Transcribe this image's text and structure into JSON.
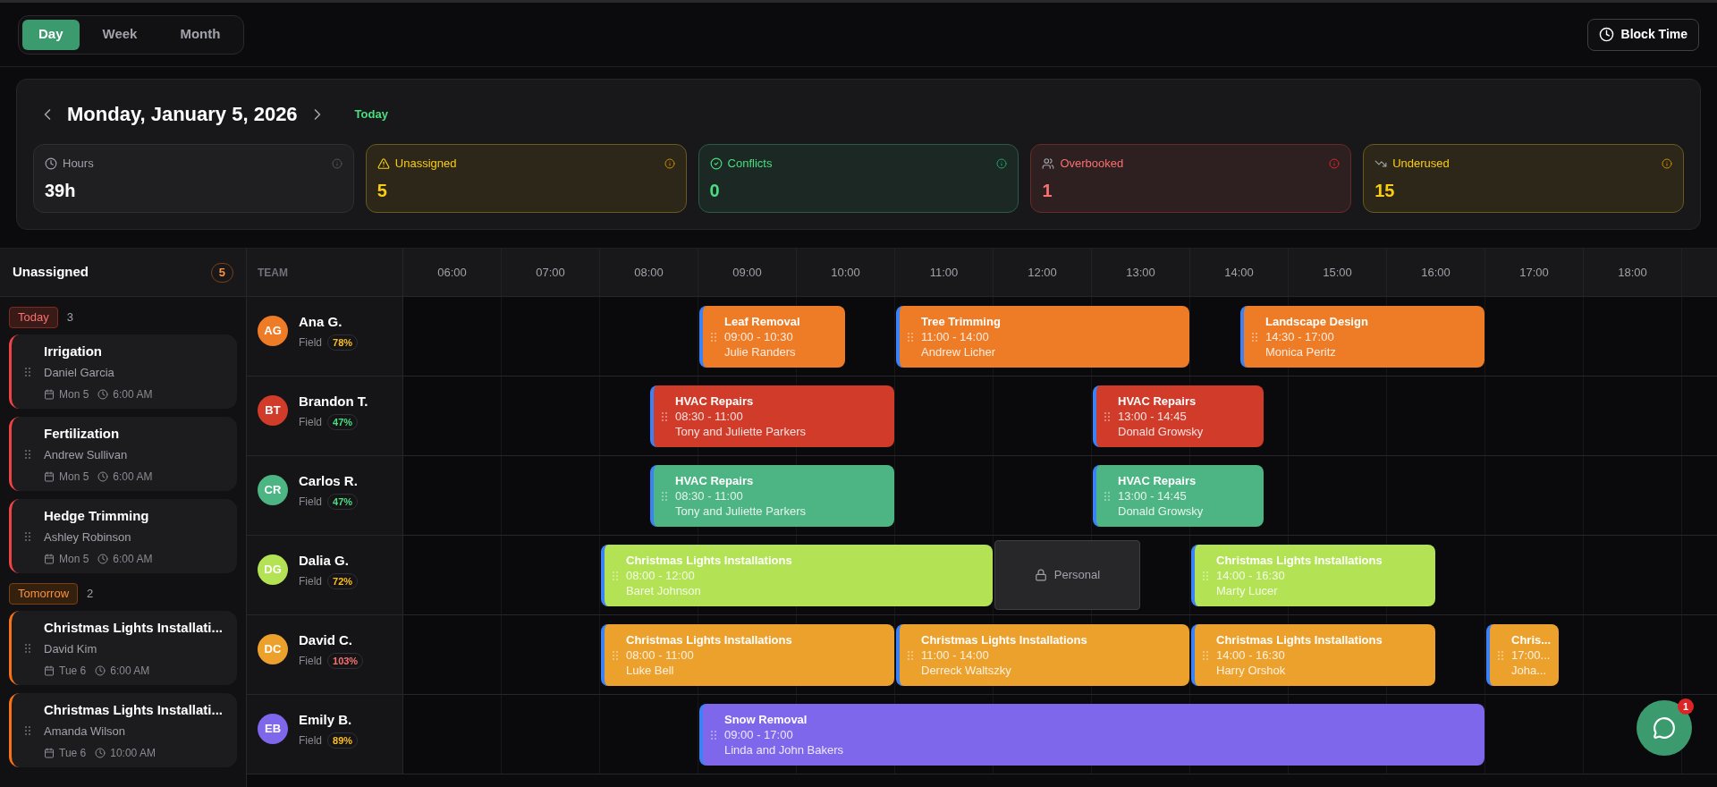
{
  "view_tabs": [
    {
      "label": "Day",
      "selected": true
    },
    {
      "label": "Week",
      "selected": false
    },
    {
      "label": "Month",
      "selected": false
    }
  ],
  "block_time_button": "Block Time",
  "date_nav": {
    "title": "Monday, January 5, 2026",
    "today_link": "Today"
  },
  "stats": [
    {
      "kind": "hours",
      "label": "Hours",
      "value": "39h"
    },
    {
      "kind": "unassigned",
      "label": "Unassigned",
      "value": "5"
    },
    {
      "kind": "conflicts",
      "label": "Conflicts",
      "value": "0"
    },
    {
      "kind": "overbooked",
      "label": "Overbooked",
      "value": "1"
    },
    {
      "kind": "underused",
      "label": "Underused",
      "value": "15"
    }
  ],
  "unassigned": {
    "title": "Unassigned",
    "count": "5",
    "groups": [
      {
        "label": "Today",
        "kind": "urgent",
        "count": "3",
        "jobs": [
          {
            "title": "Irrigation",
            "client": "Daniel Garcia",
            "date": "Mon 5",
            "time": "6:00 AM"
          },
          {
            "title": "Fertilization",
            "client": "Andrew Sullivan",
            "date": "Mon 5",
            "time": "6:00 AM"
          },
          {
            "title": "Hedge Trimming",
            "client": "Ashley Robinson",
            "date": "Mon 5",
            "time": "6:00 AM"
          }
        ]
      },
      {
        "label": "Tomorrow",
        "kind": "soon",
        "count": "2",
        "jobs": [
          {
            "title": "Christmas Lights Installati...",
            "client": "David Kim",
            "date": "Tue 6",
            "time": "6:00 AM"
          },
          {
            "title": "Christmas Lights Installati...",
            "client": "Amanda Wilson",
            "date": "Tue 6",
            "time": "10:00 AM"
          }
        ]
      }
    ]
  },
  "schedule": {
    "team_header": "TEAM",
    "hours": [
      "06:00",
      "07:00",
      "08:00",
      "09:00",
      "10:00",
      "11:00",
      "12:00",
      "13:00",
      "14:00",
      "15:00",
      "16:00",
      "17:00",
      "18:00"
    ],
    "team": [
      {
        "initials": "AG",
        "name": "Ana G.",
        "role": "Field",
        "utilization": "78%",
        "kind": "high",
        "color": "#ee7c26",
        "events": [
          {
            "kind": "job",
            "title": "Leaf Removal",
            "time": "09:00 - 10:30",
            "client": "Julie Randers"
          },
          {
            "kind": "job",
            "title": "Tree Trimming",
            "time": "11:00 - 14:00",
            "client": "Andrew Licher"
          },
          {
            "kind": "job",
            "title": "Landscape Design",
            "time": "14:30 - 17:00",
            "client": "Monica Peritz"
          }
        ]
      },
      {
        "initials": "BT",
        "name": "Brandon T.",
        "role": "Field",
        "utilization": "47%",
        "kind": "low",
        "color": "#d13b2a",
        "events": [
          {
            "kind": "job",
            "title": "HVAC Repairs",
            "time": "08:30 - 11:00",
            "client": "Tony and Juliette Parkers"
          },
          {
            "kind": "job",
            "title": "HVAC Repairs",
            "time": "13:00 - 14:45",
            "client": "Donald Growsky"
          }
        ]
      },
      {
        "initials": "CR",
        "name": "Carlos R.",
        "role": "Field",
        "utilization": "47%",
        "kind": "low",
        "color": "#4db584",
        "events": [
          {
            "kind": "job",
            "title": "HVAC Repairs",
            "time": "08:30 - 11:00",
            "client": "Tony and Juliette Parkers"
          },
          {
            "kind": "job",
            "title": "HVAC Repairs",
            "time": "13:00 - 14:45",
            "client": "Donald Growsky"
          }
        ]
      },
      {
        "initials": "DG",
        "name": "Dalia G.",
        "role": "Field",
        "utilization": "72%",
        "kind": "high",
        "color": "#b3e354",
        "events": [
          {
            "kind": "job",
            "title": "Christmas Lights Installations",
            "time": "08:00 - 12:00",
            "client": "Baret Johnson"
          },
          {
            "kind": "blocked",
            "title": "Personal"
          },
          {
            "kind": "job",
            "title": "Christmas Lights Installations",
            "time": "14:00 - 16:30",
            "client": "Marty Lucer"
          }
        ]
      },
      {
        "initials": "DC",
        "name": "David C.",
        "role": "Field",
        "utilization": "103%",
        "kind": "over",
        "color": "#eda12d",
        "events": [
          {
            "kind": "job",
            "title": "Christmas Lights Installations",
            "time": "08:00 - 11:00",
            "client": "Luke Bell"
          },
          {
            "kind": "job",
            "title": "Christmas Lights Installations",
            "time": "11:00 - 14:00",
            "client": "Derreck Waltszky"
          },
          {
            "kind": "job",
            "title": "Christmas Lights Installations",
            "time": "14:00 - 16:30",
            "client": "Harry Orshok"
          },
          {
            "kind": "job",
            "title": "Chris...",
            "time": "17:00...",
            "client": "Joha..."
          }
        ]
      },
      {
        "initials": "EB",
        "name": "Emily B.",
        "role": "Field",
        "utilization": "89%",
        "kind": "high",
        "color": "#7f67ec",
        "events": [
          {
            "kind": "job",
            "title": "Snow Removal",
            "time": "09:00 - 17:00",
            "client": "Linda and John Bakers"
          }
        ]
      }
    ]
  },
  "chat": {
    "badge": "1"
  }
}
